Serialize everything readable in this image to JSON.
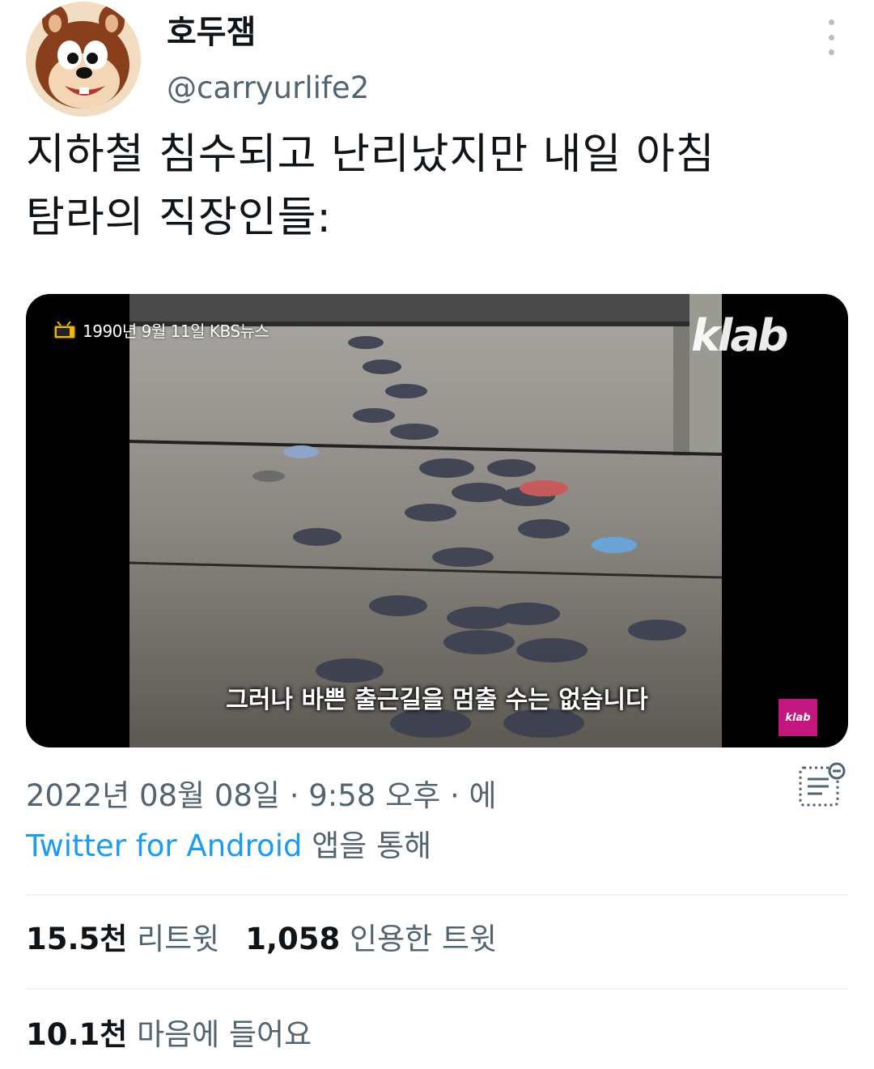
{
  "author": {
    "display_name": "호두잼",
    "handle": "@carryurlife2"
  },
  "tweet": {
    "text": "지하철 침수되고 난리났지만 내일 아침\n탐라의 직장인들:"
  },
  "media": {
    "news_tag": "1990년 9월 11일 KBS뉴스",
    "logo": "klab",
    "subtitle": "그러나 바쁜 출근길을 멈출 수는 없습니다",
    "badge": "klab"
  },
  "meta": {
    "timestamp": "2022년 08월 08일 · 9:58 오후 · 에",
    "source": "Twitter for Android",
    "source_suffix": " 앱을 통해"
  },
  "stats": {
    "retweets_count": "15.5천",
    "retweets_label": " 리트윗",
    "quotes_count": "1,058",
    "quotes_label": " 인용한 트윗",
    "likes_count": "10.1천",
    "likes_label": " 마음에 들어요"
  },
  "colors": {
    "link": "#1d9bf0",
    "secondary_text": "#536471",
    "primary_text": "#0f1419",
    "badge": "#c4167f"
  }
}
